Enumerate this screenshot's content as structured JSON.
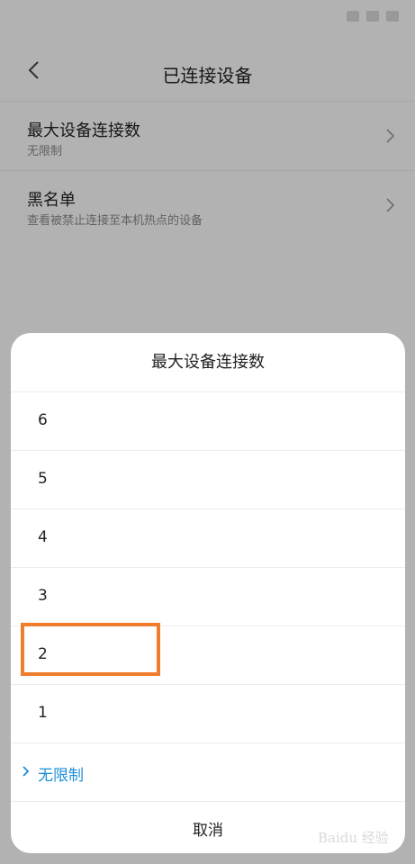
{
  "header": {
    "title": "已连接设备"
  },
  "settings": [
    {
      "title": "最大设备连接数",
      "subtitle": "无限制"
    },
    {
      "title": "黑名单",
      "subtitle": "查看被禁止连接至本机热点的设备"
    }
  ],
  "sheet": {
    "title": "最大设备连接数",
    "options": [
      "6",
      "5",
      "4",
      "3",
      "2",
      "1",
      "无限制"
    ],
    "selected_option": "无限制",
    "cancel_label": "取消"
  },
  "watermark": {
    "text": "Baidu 经验"
  },
  "colors": {
    "accent": "#1e8fd6",
    "highlight": "#f07d2d"
  }
}
